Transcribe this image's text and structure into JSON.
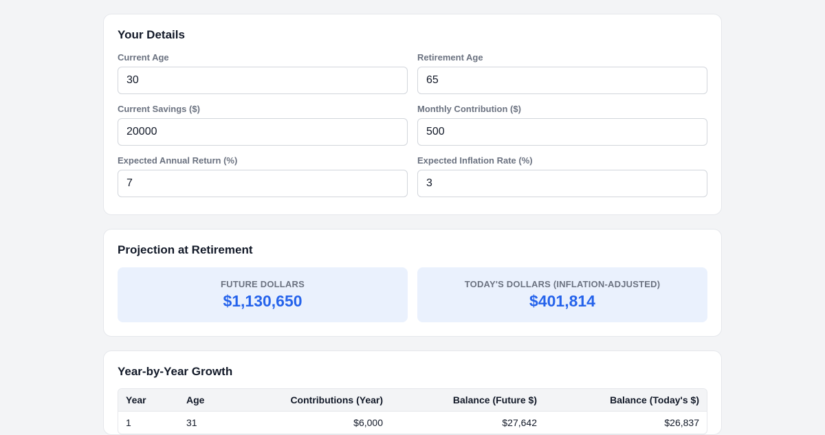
{
  "details": {
    "title": "Your Details",
    "fields": [
      {
        "label": "Current Age",
        "value": "30"
      },
      {
        "label": "Retirement Age",
        "value": "65"
      },
      {
        "label": "Current Savings ($)",
        "value": "20000"
      },
      {
        "label": "Monthly Contribution ($)",
        "value": "500"
      },
      {
        "label": "Expected Annual Return (%)",
        "value": "7"
      },
      {
        "label": "Expected Inflation Rate (%)",
        "value": "3"
      }
    ]
  },
  "projection": {
    "title": "Projection at Retirement",
    "future_label": "FUTURE DOLLARS",
    "future_value": "$1,130,650",
    "today_label": "TODAY'S DOLLARS (INFLATION-ADJUSTED)",
    "today_value": "$401,814"
  },
  "growth": {
    "title": "Year-by-Year Growth",
    "columns": [
      "Year",
      "Age",
      "Contributions (Year)",
      "Balance (Future $)",
      "Balance (Today's $)"
    ],
    "rows": [
      [
        "1",
        "31",
        "$6,000",
        "$27,642",
        "$26,837"
      ]
    ]
  },
  "colors": {
    "accent": "#2563eb",
    "stat_bg": "#eaf1fd",
    "page_bg": "#f3f4f6"
  }
}
